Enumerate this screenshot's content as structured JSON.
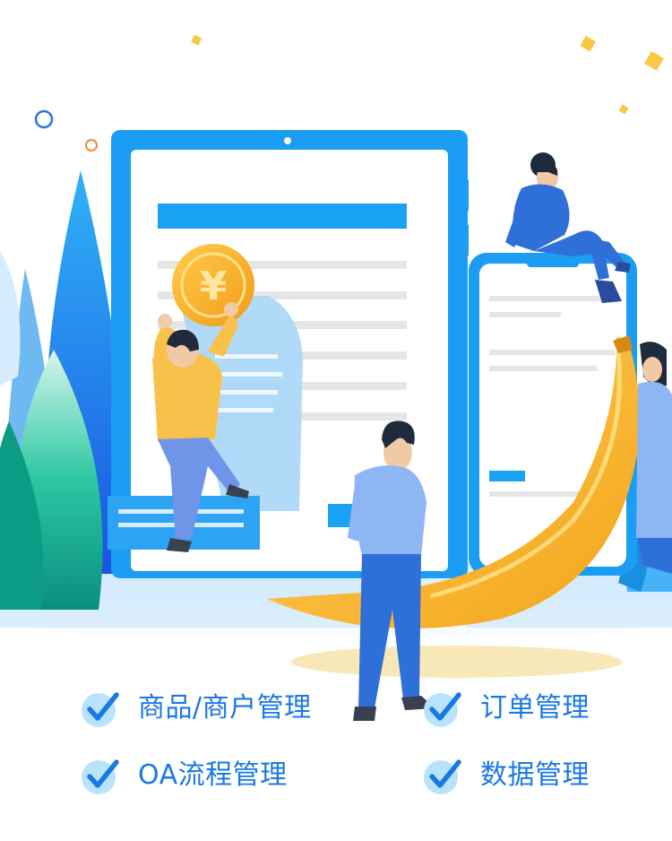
{
  "illustration": {
    "coin_symbol": "¥"
  },
  "features": [
    {
      "label": "商品/商户管理",
      "icon": "check-circle-icon"
    },
    {
      "label": "订单管理",
      "icon": "check-circle-icon"
    },
    {
      "label": "OA流程管理",
      "icon": "check-circle-icon"
    },
    {
      "label": "数据管理",
      "icon": "check-circle-icon"
    }
  ],
  "colors": {
    "primary_blue": "#1a78e6",
    "sky_blue": "#2ea7f5",
    "banana_yellow": "#f6b82b",
    "check_bg": "#b8e3fb"
  }
}
